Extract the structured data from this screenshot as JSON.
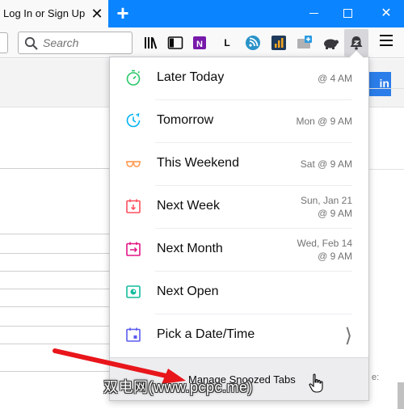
{
  "tab": {
    "title": "Log In or Sign Up",
    "close": "✕"
  },
  "newtab": {
    "symbol": "+"
  },
  "window": {
    "close": "✕"
  },
  "search": {
    "placeholder": "Search"
  },
  "toolbar_icons": [
    "library-icon",
    "sidebar-icon",
    "onenote-icon",
    "lastpass-icon",
    "feed-icon",
    "analytics-icon",
    "screenshot-icon",
    "turtle-icon",
    "snooze-bell-icon"
  ],
  "toolbar_icon_text": {
    "lastpass": "L"
  },
  "page": {
    "signin_partial": "in",
    "right_partial": "e:"
  },
  "snooze": {
    "accent": "#0a84ff",
    "options": [
      {
        "label": "Later Today",
        "time": "@ 4 AM",
        "icon": "stopwatch-icon",
        "color": "#2ac769"
      },
      {
        "label": "Tomorrow",
        "time": "Mon @ 9 AM",
        "icon": "clock-icon",
        "color": "#00b3f4"
      },
      {
        "label": "This Weekend",
        "time": "Sat @ 9 AM",
        "icon": "sunglasses-icon",
        "color": "#ff9f5a"
      },
      {
        "label": "Next Week",
        "time_line1": "Sun, Jan 21",
        "time_line2": "@ 9 AM",
        "icon": "calendar-down-icon",
        "color": "#ff4f5e"
      },
      {
        "label": "Next Month",
        "time_line1": "Wed, Feb 14",
        "time_line2": "@ 9 AM",
        "icon": "calendar-next-icon",
        "color": "#e31587"
      },
      {
        "label": "Next Open",
        "time": "",
        "icon": "browser-open-icon",
        "color": "#12bc9c"
      },
      {
        "label": "Pick a Date/Time",
        "chevron": "⟩",
        "icon": "calendar-pick-icon",
        "color": "#5b5bf0"
      }
    ],
    "manage_label": "Manage Snoozed Tabs"
  },
  "watermark": "双电网(www.pcpc.me)"
}
